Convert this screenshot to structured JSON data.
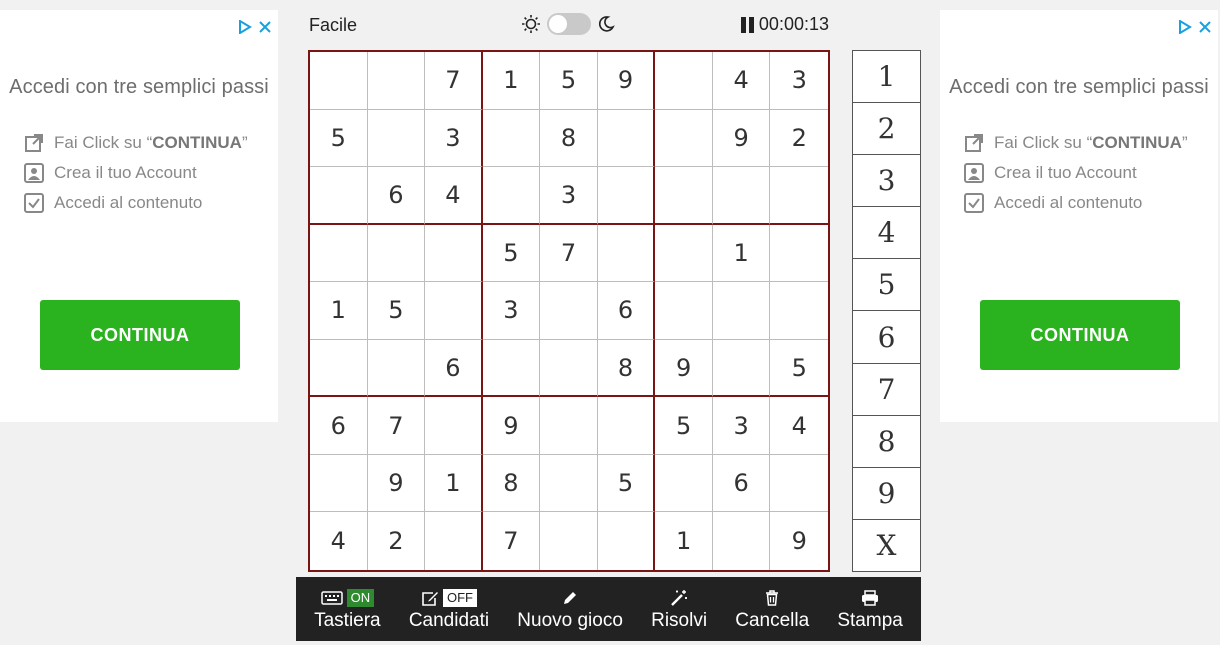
{
  "ads": [
    {
      "title": "Accedi con tre semplici passi",
      "steps": [
        {
          "icon": "external-link-icon",
          "text_pre": "Fai Click su “",
          "text_bold": "CONTINUA",
          "text_post": "”"
        },
        {
          "icon": "account-icon",
          "text_pre": "Crea il tuo Account",
          "text_bold": "",
          "text_post": ""
        },
        {
          "icon": "checkbox-icon",
          "text_pre": "Accedi al contenuto",
          "text_bold": "",
          "text_post": ""
        }
      ],
      "cta": "CONTINUA"
    },
    {
      "title": "Accedi con tre semplici passi",
      "steps": [
        {
          "icon": "external-link-icon",
          "text_pre": "Fai Click su “",
          "text_bold": "CONTINUA",
          "text_post": "”"
        },
        {
          "icon": "account-icon",
          "text_pre": "Crea il tuo Account",
          "text_bold": "",
          "text_post": ""
        },
        {
          "icon": "checkbox-icon",
          "text_pre": "Accedi al contenuto",
          "text_bold": "",
          "text_post": ""
        }
      ],
      "cta": "CONTINUA"
    }
  ],
  "topbar": {
    "difficulty": "Facile",
    "theme_toggle": "light",
    "timer": "00:00:13"
  },
  "grid": [
    [
      "",
      "",
      "7",
      "1",
      "5",
      "9",
      "",
      "4",
      "3"
    ],
    [
      "5",
      "",
      "3",
      "",
      "8",
      "",
      "",
      "9",
      "2"
    ],
    [
      "",
      "6",
      "4",
      "",
      "3",
      "",
      "",
      "",
      ""
    ],
    [
      "",
      "",
      "",
      "5",
      "7",
      "",
      "",
      "1",
      ""
    ],
    [
      "1",
      "5",
      "",
      "3",
      "",
      "6",
      "",
      "",
      ""
    ],
    [
      "",
      "",
      "6",
      "",
      "",
      "8",
      "9",
      "",
      "5"
    ],
    [
      "6",
      "7",
      "",
      "9",
      "",
      "",
      "5",
      "3",
      "4"
    ],
    [
      "",
      "9",
      "1",
      "8",
      "",
      "5",
      "",
      "6",
      ""
    ],
    [
      "4",
      "2",
      "",
      "7",
      "",
      "",
      "1",
      "",
      "9"
    ]
  ],
  "numpad": [
    "1",
    "2",
    "3",
    "4",
    "5",
    "6",
    "7",
    "8",
    "9",
    "X"
  ],
  "toolbar": {
    "keyboard": {
      "label": "Tastiera",
      "state": "ON"
    },
    "candidates": {
      "label": "Candidati",
      "state": "OFF"
    },
    "new_game": {
      "label": "Nuovo gioco"
    },
    "solve": {
      "label": "Risolvi"
    },
    "clear": {
      "label": "Cancella"
    },
    "print": {
      "label": "Stampa"
    }
  },
  "colors": {
    "board_border": "#7a1515",
    "cta_green": "#2ab31e",
    "toolbar_bg": "#222222",
    "on_badge": "#2f8a2f"
  }
}
